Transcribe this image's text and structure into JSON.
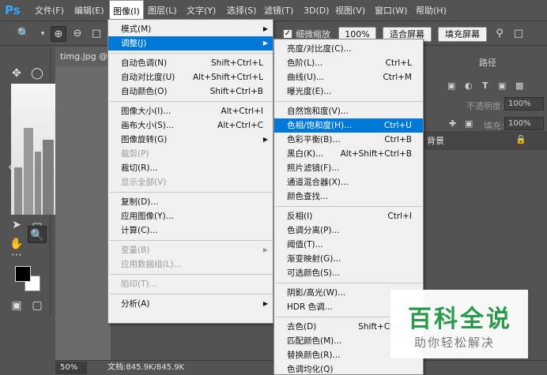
{
  "app": {
    "logo": "Ps"
  },
  "menubar": [
    {
      "label": "文件(F)",
      "active": false
    },
    {
      "label": "编辑(E)",
      "active": false
    },
    {
      "label": "图像(I)",
      "active": true
    },
    {
      "label": "图层(L)",
      "active": false
    },
    {
      "label": "文字(Y)",
      "active": false
    },
    {
      "label": "选择(S)",
      "active": false
    },
    {
      "label": "滤镜(T)",
      "active": false
    },
    {
      "label": "3D(D)",
      "active": false
    },
    {
      "label": "视图(V)",
      "active": false
    },
    {
      "label": "窗口(W)",
      "active": false
    },
    {
      "label": "帮助(H)",
      "active": false
    }
  ],
  "options": {
    "scrubby_zoom": "细微缩放",
    "zoom_100": "100%",
    "fit_screen": "适合屏幕",
    "fill_screen": "填充屏幕"
  },
  "document": {
    "tab_title": "timg.jpg @",
    "zoom": "50%",
    "doc_size": "文档:845.9K/845.9K"
  },
  "panels": {
    "paths_tab": "路径",
    "opacity_label": "不透明度:",
    "opacity_value": "100%",
    "fill_label": "填充:",
    "fill_value": "100%",
    "layer_name": "背景"
  },
  "image_menu": {
    "groups": [
      [
        {
          "label": "模式(M)",
          "shortcut": "",
          "submenu": true,
          "disabled": false,
          "highlighted": false
        },
        {
          "label": "调整(J)",
          "shortcut": "",
          "submenu": true,
          "disabled": false,
          "highlighted": true
        }
      ],
      [
        {
          "label": "自动色调(N)",
          "shortcut": "Shift+Ctrl+L",
          "submenu": false,
          "disabled": false,
          "highlighted": false
        },
        {
          "label": "自动对比度(U)",
          "shortcut": "Alt+Shift+Ctrl+L",
          "submenu": false,
          "disabled": false,
          "highlighted": false
        },
        {
          "label": "自动颜色(O)",
          "shortcut": "Shift+Ctrl+B",
          "submenu": false,
          "disabled": false,
          "highlighted": false
        }
      ],
      [
        {
          "label": "图像大小(I)...",
          "shortcut": "Alt+Ctrl+I",
          "submenu": false,
          "disabled": false,
          "highlighted": false
        },
        {
          "label": "画布大小(S)...",
          "shortcut": "Alt+Ctrl+C",
          "submenu": false,
          "disabled": false,
          "highlighted": false
        },
        {
          "label": "图像旋转(G)",
          "shortcut": "",
          "submenu": true,
          "disabled": false,
          "highlighted": false
        },
        {
          "label": "裁剪(P)",
          "shortcut": "",
          "submenu": false,
          "disabled": true,
          "highlighted": false
        },
        {
          "label": "裁切(R)...",
          "shortcut": "",
          "submenu": false,
          "disabled": false,
          "highlighted": false
        },
        {
          "label": "显示全部(V)",
          "shortcut": "",
          "submenu": false,
          "disabled": true,
          "highlighted": false
        }
      ],
      [
        {
          "label": "复制(D)...",
          "shortcut": "",
          "submenu": false,
          "disabled": false,
          "highlighted": false
        },
        {
          "label": "应用图像(Y)...",
          "shortcut": "",
          "submenu": false,
          "disabled": false,
          "highlighted": false
        },
        {
          "label": "计算(C)...",
          "shortcut": "",
          "submenu": false,
          "disabled": false,
          "highlighted": false
        }
      ],
      [
        {
          "label": "变量(B)",
          "shortcut": "",
          "submenu": true,
          "disabled": true,
          "highlighted": false
        },
        {
          "label": "应用数据组(L)...",
          "shortcut": "",
          "submenu": false,
          "disabled": true,
          "highlighted": false
        }
      ],
      [
        {
          "label": "陷印(T)...",
          "shortcut": "",
          "submenu": false,
          "disabled": true,
          "highlighted": false
        }
      ],
      [
        {
          "label": "分析(A)",
          "shortcut": "",
          "submenu": true,
          "disabled": false,
          "highlighted": false
        }
      ]
    ]
  },
  "adjust_menu": {
    "groups": [
      [
        {
          "label": "亮度/对比度(C)...",
          "shortcut": "",
          "highlighted": false
        },
        {
          "label": "色阶(L)...",
          "shortcut": "Ctrl+L",
          "highlighted": false
        },
        {
          "label": "曲线(U)...",
          "shortcut": "Ctrl+M",
          "highlighted": false
        },
        {
          "label": "曝光度(E)...",
          "shortcut": "",
          "highlighted": false
        }
      ],
      [
        {
          "label": "自然饱和度(V)...",
          "shortcut": "",
          "highlighted": false
        },
        {
          "label": "色相/饱和度(H)...",
          "shortcut": "Ctrl+U",
          "highlighted": true
        },
        {
          "label": "色彩平衡(B)...",
          "shortcut": "Ctrl+B",
          "highlighted": false
        },
        {
          "label": "黑白(K)...",
          "shortcut": "Alt+Shift+Ctrl+B",
          "highlighted": false
        },
        {
          "label": "照片滤镜(F)...",
          "shortcut": "",
          "highlighted": false
        },
        {
          "label": "通道混合器(X)...",
          "shortcut": "",
          "highlighted": false
        },
        {
          "label": "颜色查找...",
          "shortcut": "",
          "highlighted": false
        }
      ],
      [
        {
          "label": "反相(I)",
          "shortcut": "Ctrl+I",
          "highlighted": false
        },
        {
          "label": "色调分离(P)...",
          "shortcut": "",
          "highlighted": false
        },
        {
          "label": "阈值(T)...",
          "shortcut": "",
          "highlighted": false
        },
        {
          "label": "渐变映射(G)...",
          "shortcut": "",
          "highlighted": false
        },
        {
          "label": "可选颜色(S)...",
          "shortcut": "",
          "highlighted": false
        }
      ],
      [
        {
          "label": "阴影/高光(W)...",
          "shortcut": "",
          "highlighted": false
        },
        {
          "label": "HDR 色调...",
          "shortcut": "",
          "highlighted": false
        }
      ],
      [
        {
          "label": "去色(D)",
          "shortcut": "Shift+Ctrl+U",
          "highlighted": false
        },
        {
          "label": "匹配颜色(M)...",
          "shortcut": "",
          "highlighted": false
        },
        {
          "label": "替换颜色(R)...",
          "shortcut": "",
          "highlighted": false
        },
        {
          "label": "色调均化(Q)",
          "shortcut": "",
          "highlighted": false
        }
      ]
    ]
  },
  "watermark": {
    "title": "百科全说",
    "subtitle": "助你轻松解决"
  },
  "icons": {
    "zoom_tool": "zoom-icon",
    "zoom_in": "zoom-in-icon",
    "zoom_out": "zoom-out-icon",
    "hand": "hand-icon",
    "lock": "lock-icon"
  }
}
